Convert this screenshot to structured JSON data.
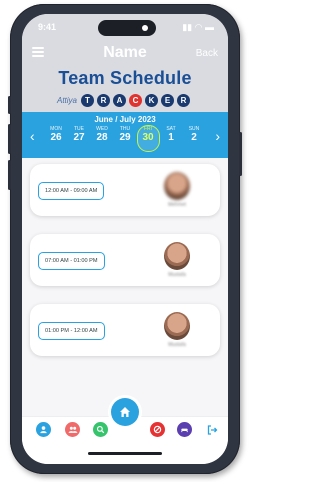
{
  "status": {
    "time": "9:41",
    "icons": "▮▮ ◠ ▬"
  },
  "nav": {
    "title": "Name",
    "back_label": "Back"
  },
  "page": {
    "title": "Team Schedule"
  },
  "brand": {
    "word": "Attiya",
    "letters": [
      "T",
      "R",
      "A",
      "C",
      "K",
      "E",
      "R"
    ]
  },
  "calendar": {
    "month_label": "June / July 2023",
    "days": [
      {
        "name": "MON",
        "date": "26"
      },
      {
        "name": "TUE",
        "date": "27"
      },
      {
        "name": "WED",
        "date": "28"
      },
      {
        "name": "THU",
        "date": "29"
      },
      {
        "name": "FRI",
        "date": "30",
        "selected": true
      },
      {
        "name": "SAT",
        "date": "1"
      },
      {
        "name": "SUN",
        "date": "2"
      }
    ]
  },
  "shifts": [
    {
      "time": "12:00 AM - 09:00 AM",
      "name": "Mehmet"
    },
    {
      "time": "07:00 AM - 01:00 PM",
      "name": "Mustafa"
    },
    {
      "time": "01:00 PM - 12:00 AM",
      "name": "Mustafa"
    }
  ],
  "colors": {
    "accent": "#2aa2df",
    "title": "#1a4f96",
    "highlight": "#c8f542"
  }
}
